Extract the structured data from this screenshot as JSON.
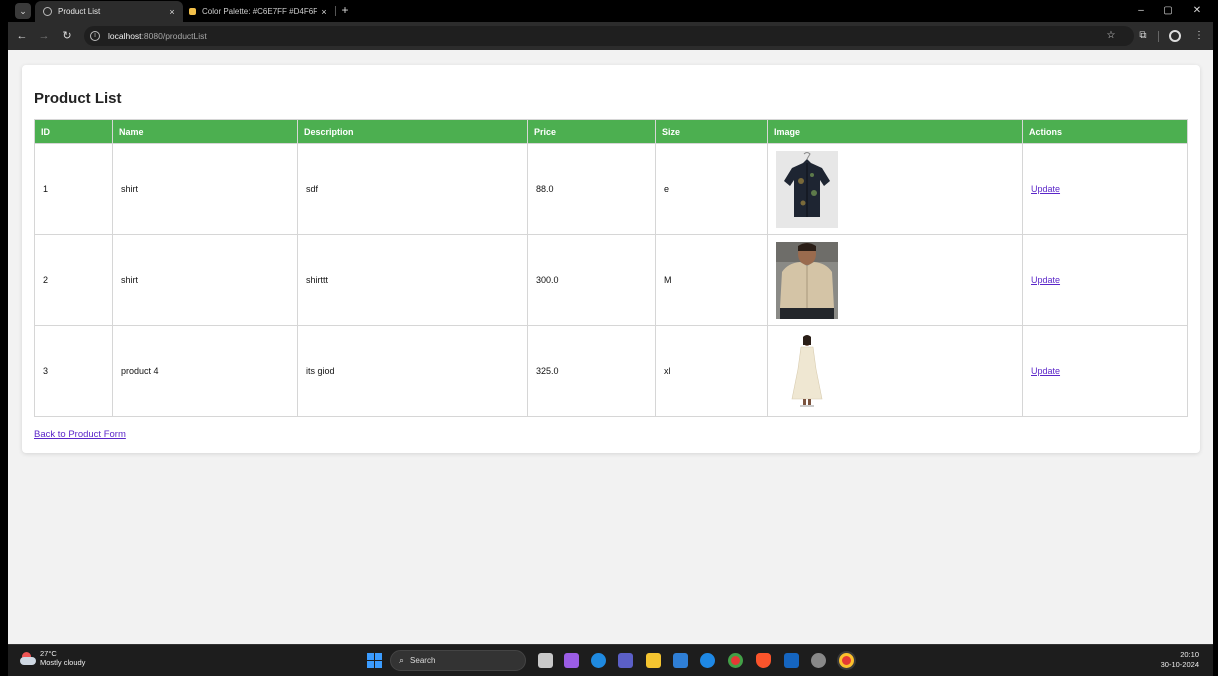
{
  "browser": {
    "tabs": [
      {
        "title": "Product List",
        "active": true
      },
      {
        "title": "Color Palette: #C6E7FF #D4F6FF",
        "active": false
      }
    ],
    "tab_close_glyph": "×",
    "new_tab_glyph": "+",
    "url_host": "localhost",
    "url_rest": ":8080/productList",
    "window_controls": {
      "minimize": "–",
      "restore": "▢",
      "close": "✕"
    }
  },
  "page": {
    "title": "Product List",
    "columns": [
      "ID",
      "Name",
      "Description",
      "Price",
      "Size",
      "Image",
      "Actions"
    ],
    "rows": [
      {
        "id": "1",
        "name": "shirt",
        "description": "sdf",
        "price": "88.0",
        "size": "e",
        "image": "dark-print-shirt",
        "action": "Update"
      },
      {
        "id": "2",
        "name": "shirt",
        "description": "shirttt",
        "price": "300.0",
        "size": "M",
        "image": "beige-shirt-model",
        "action": "Update"
      },
      {
        "id": "3",
        "name": "product 4",
        "description": "its giod",
        "price": "325.0",
        "size": "xl",
        "image": "cream-dress-model",
        "action": "Update"
      }
    ],
    "back_link": "Back to Product Form",
    "header_color": "#4caf50",
    "link_color": "#5b26c9"
  },
  "taskbar": {
    "weather_temp": "27°C",
    "weather_desc": "Mostly cloudy",
    "search_label": "Search",
    "time": "20:10",
    "date": "30-10-2024"
  }
}
